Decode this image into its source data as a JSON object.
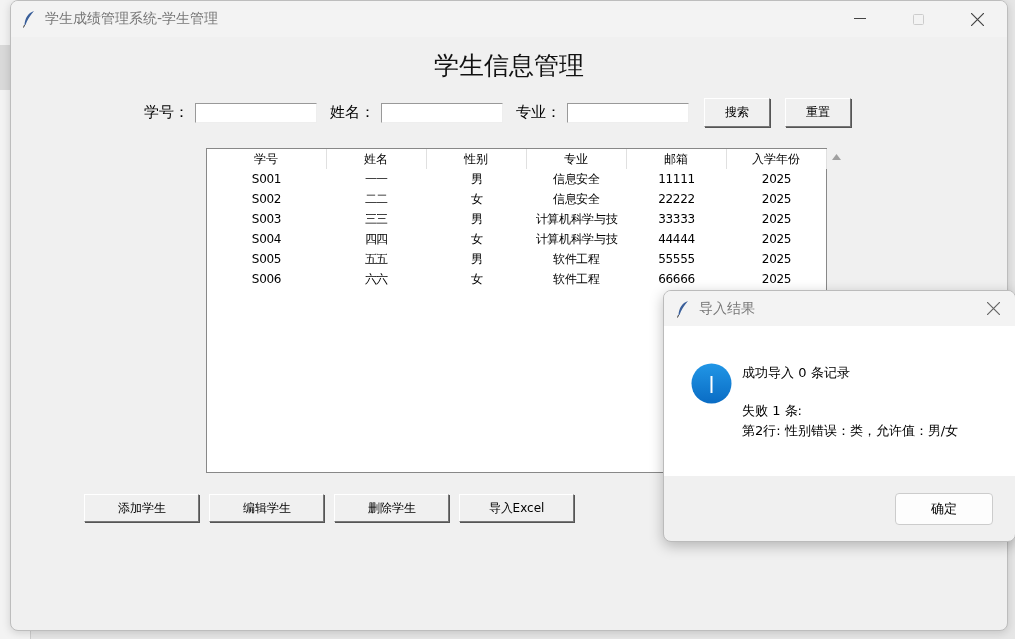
{
  "window": {
    "title": "学生成绩管理系统-学生管理"
  },
  "heading": "学生信息管理",
  "search": {
    "fields": [
      {
        "label": "学号："
      },
      {
        "label": "姓名："
      },
      {
        "label": "专业："
      }
    ],
    "buttons": [
      "搜索",
      "重置"
    ]
  },
  "table": {
    "columns": [
      "学号",
      "姓名",
      "性别",
      "专业",
      "邮箱",
      "入学年份"
    ],
    "rows": [
      [
        "S001",
        "一一",
        "男",
        "信息安全",
        "11111",
        "2025"
      ],
      [
        "S002",
        "二二",
        "女",
        "信息安全",
        "22222",
        "2025"
      ],
      [
        "S003",
        "三三",
        "男",
        "计算机科学与技",
        "33333",
        "2025"
      ],
      [
        "S004",
        "四四",
        "女",
        "计算机科学与技",
        "44444",
        "2025"
      ],
      [
        "S005",
        "五五",
        "男",
        "软件工程",
        "55555",
        "2025"
      ],
      [
        "S006",
        "六六",
        "女",
        "软件工程",
        "66666",
        "2025"
      ]
    ]
  },
  "actions": [
    "添加学生",
    "编辑学生",
    "删除学生",
    "导入Excel"
  ],
  "dialog": {
    "title": "导入结果",
    "message": "成功导入 0 条记录",
    "details": [
      "失败 1 条:",
      "第2行: 性别错误：类，允许值：男/女"
    ],
    "button": "确定"
  }
}
